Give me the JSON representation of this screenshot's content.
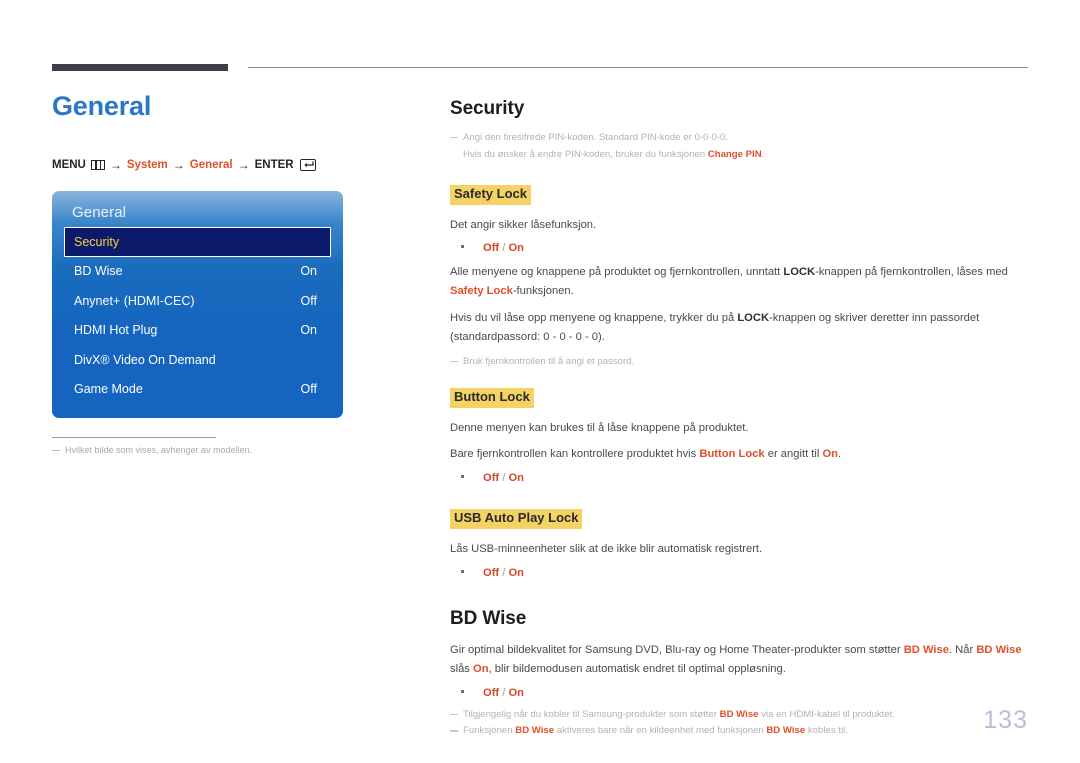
{
  "page": {
    "number": "133"
  },
  "left": {
    "title": "General",
    "menu_path": {
      "menu_label": "MENU",
      "menu_icon": "menu-grid-icon",
      "arrow": "→",
      "step1": "System",
      "step2": "General",
      "enter_label": "ENTER",
      "enter_icon": "enter-key-icon"
    },
    "osd": {
      "title": "General",
      "rows": [
        {
          "label": "Security",
          "value": "",
          "selected": true
        },
        {
          "label": "BD Wise",
          "value": "On",
          "selected": false
        },
        {
          "label": "Anynet+ (HDMI-CEC)",
          "value": "Off",
          "selected": false
        },
        {
          "label": "HDMI Hot Plug",
          "value": "On",
          "selected": false
        },
        {
          "label": "DivX® Video On Demand",
          "value": "",
          "selected": false
        },
        {
          "label": "Game Mode",
          "value": "Off",
          "selected": false
        }
      ]
    },
    "panel_note": "Hvilket bilde som vises, avhenger av modellen."
  },
  "right": {
    "security": {
      "title": "Security",
      "note_line_1": "Angi den firesifrede PIN-koden. Standard PIN-kode er 0-0-0-0.",
      "note_line_2_pre": "Hvis du ønsker å endre PIN-koden, bruker du funksjonen ",
      "note_line_2_accent": "Change PIN",
      "note_line_2_post": "."
    },
    "safety_lock": {
      "heading": "Safety Lock",
      "p1": "Det angir sikker låsefunksjon.",
      "bullet": {
        "off": "Off",
        "sep": " / ",
        "on": "On"
      },
      "p2_a": "Alle menyene og knappene på produktet og fjernkontrollen, unntatt ",
      "p2_b": "LOCK",
      "p2_c": "-knappen på fjernkontrollen, låses med ",
      "p2_d": "Safety Lock",
      "p2_e": "-funksjonen.",
      "p3_a": "Hvis du vil låse opp menyene og knappene, trykker du på ",
      "p3_b": "LOCK",
      "p3_c": "-knappen og skriver deretter inn passordet (standardpassord: 0 - 0 - 0 - 0).",
      "note": "Bruk fjernkontrollen til å angi et passord."
    },
    "button_lock": {
      "heading": "Button Lock",
      "p1": "Denne menyen kan brukes til å låse knappene på produktet.",
      "p2_a": "Bare fjernkontrollen kan kontrollere produktet hvis ",
      "p2_b": "Button Lock",
      "p2_c": " er angitt til ",
      "p2_d": "On",
      "p2_e": ".",
      "bullet": {
        "off": "Off",
        "sep": " / ",
        "on": "On"
      }
    },
    "usb_auto_play_lock": {
      "heading": "USB Auto Play Lock",
      "p1": "Lås USB-minneenheter slik at de ikke blir automatisk registrert.",
      "bullet": {
        "off": "Off",
        "sep": " / ",
        "on": "On"
      }
    },
    "bd_wise": {
      "title": "BD Wise",
      "p1_a": "Gir optimal bildekvalitet for Samsung DVD, Blu-ray og Home Theater-produkter som støtter ",
      "p1_b": "BD Wise",
      "p1_c": ". Når ",
      "p1_d": "BD Wise",
      "p1_e": " slås ",
      "p1_f": "On",
      "p1_g": ", blir bildemodusen automatisk endret til optimal oppløsning.",
      "bullet": {
        "off": "Off",
        "sep": " / ",
        "on": "On"
      },
      "note1_a": "Tilgjengelig når du kobler til Samsung-produkter som støtter ",
      "note1_b": "BD Wise",
      "note1_c": " via en HDMI-kabel til produktet.",
      "note2_a": "Funksjonen ",
      "note2_b": "BD Wise",
      "note2_c": " aktiveres bare når en kildeenhet med funksjonen ",
      "note2_d": "BD Wise",
      "note2_e": " kobles til."
    }
  },
  "colors": {
    "heading_blue": "#2a77c4",
    "accent_orange": "#e0502a",
    "highlight_yellow": "#f5d264",
    "osd_blue": "#1565c0",
    "osd_selected": "#0d1a6b",
    "osd_selected_text": "#f5d14a",
    "page_number": "#b9bfd4"
  }
}
